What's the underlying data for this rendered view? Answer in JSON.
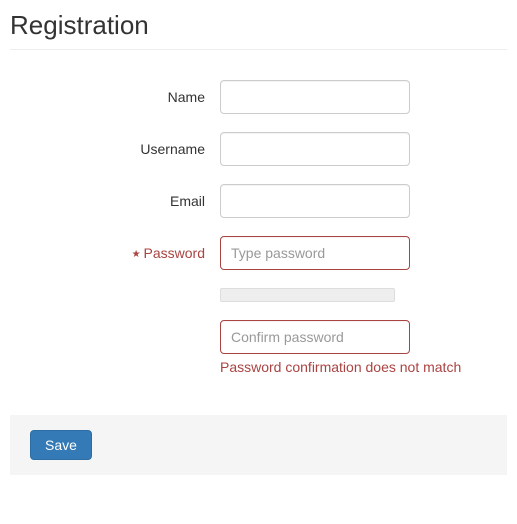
{
  "title": "Registration",
  "fields": {
    "name": {
      "label": "Name",
      "value": ""
    },
    "username": {
      "label": "Username",
      "value": ""
    },
    "email": {
      "label": "Email",
      "value": ""
    },
    "password": {
      "label": "Password",
      "placeholder": "Type password",
      "value": "",
      "required_icon": "★"
    },
    "password_confirm": {
      "placeholder": "Confirm password",
      "value": "",
      "error": "Password confirmation does not match"
    }
  },
  "actions": {
    "save": "Save"
  }
}
